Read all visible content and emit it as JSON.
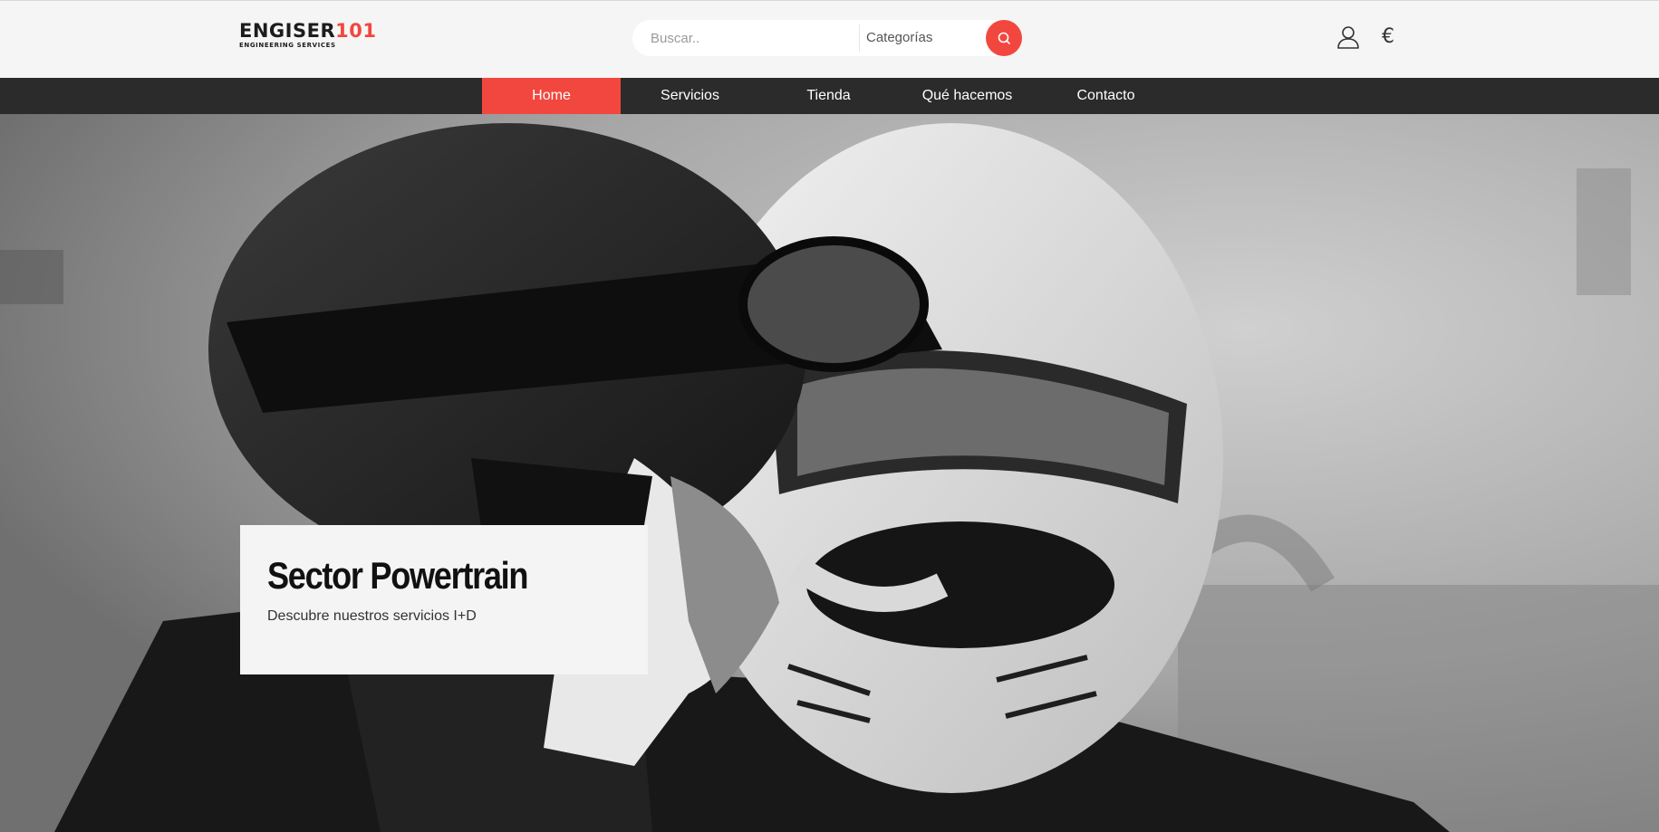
{
  "header": {
    "logo": {
      "brand_dark": "ENGISER",
      "brand_accent": "101",
      "tagline": "ENGINEERING SERVICES"
    },
    "search": {
      "placeholder": "Buscar..",
      "value": "",
      "category": "Categorías"
    },
    "icons": {
      "account": "user-icon",
      "currency": "€"
    }
  },
  "nav": {
    "items": [
      {
        "label": "Home",
        "active": true
      },
      {
        "label": "Servicios",
        "active": false
      },
      {
        "label": "Tienda",
        "active": false
      },
      {
        "label": "Qué hacemos",
        "active": false
      },
      {
        "label": "Contacto",
        "active": false
      }
    ]
  },
  "hero": {
    "title": "Sector Powertrain",
    "subtitle": "Descubre nuestros servicios I+D"
  },
  "colors": {
    "accent": "#f2473f",
    "nav_bg": "#2b2b2b",
    "header_bg": "#f5f5f5"
  }
}
